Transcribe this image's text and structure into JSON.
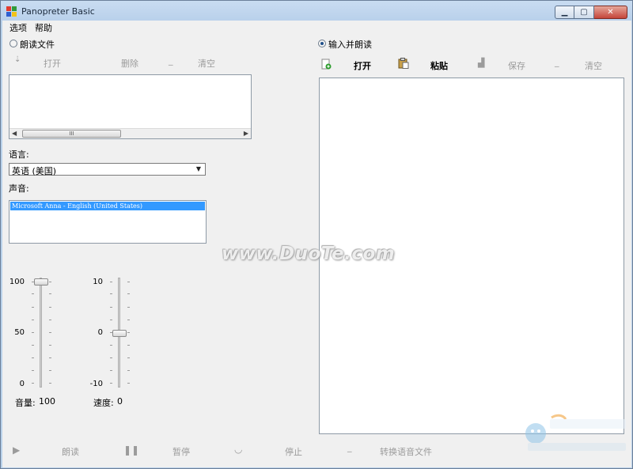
{
  "window": {
    "title": "Panopreter Basic"
  },
  "menu": {
    "items": [
      "选项",
      "帮助"
    ]
  },
  "left": {
    "mode_label": "朗读文件",
    "toolbar": {
      "open": "打开",
      "delete": "删除",
      "clear": "清空"
    },
    "scroll_grip": "III",
    "language_label": "语言:",
    "language_value": "英语 (美国)",
    "voice_label": "声音:",
    "voice_selected": "Microsoft Anna - English (United States)",
    "volume": {
      "scale_top": "100",
      "scale_mid": "50",
      "scale_bottom": "0",
      "label": "音量:",
      "value": "100",
      "level": 100
    },
    "speed": {
      "scale_top": "10",
      "scale_mid": "0",
      "scale_bottom": "-10",
      "label": "速度:",
      "value": "0",
      "level": 0
    }
  },
  "right": {
    "mode_label": "输入并朗读",
    "toolbar": {
      "open": "打开",
      "paste": "粘贴",
      "save": "保存",
      "clear": "清空"
    }
  },
  "bottom": {
    "read": "朗读",
    "pause": "暂停",
    "stop": "停止",
    "convert": "转换语音文件"
  },
  "watermark": {
    "text": "www.DuoTe.com"
  },
  "colors": {
    "selection": "#3399ff",
    "titlebar": "#b9d1ea",
    "client": "#f0f0f0"
  }
}
